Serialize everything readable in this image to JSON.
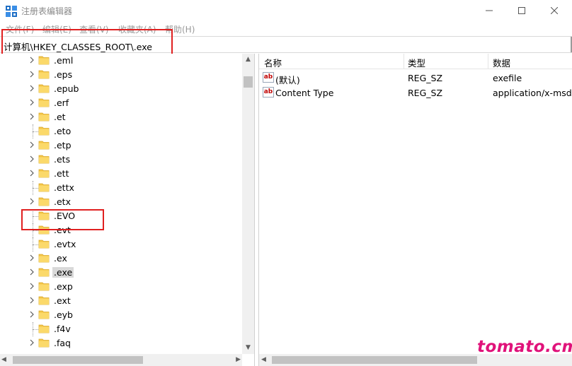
{
  "window": {
    "title": "注册表编辑器",
    "controls": {
      "minimize": "—",
      "maximize": "☐",
      "close": "✕"
    }
  },
  "menu": [
    {
      "label": "文件(F)"
    },
    {
      "label": "编辑(E)"
    },
    {
      "label": "查看(V)"
    },
    {
      "label": "收藏夹(A)"
    },
    {
      "label": "帮助(H)"
    }
  ],
  "address": {
    "path": "计算机\\HKEY_CLASSES_ROOT\\.exe"
  },
  "tree": {
    "items": [
      {
        "label": ".eml",
        "expandable": true,
        "selected": false
      },
      {
        "label": ".eps",
        "expandable": true,
        "selected": false
      },
      {
        "label": ".epub",
        "expandable": true,
        "selected": false
      },
      {
        "label": ".erf",
        "expandable": true,
        "selected": false
      },
      {
        "label": ".et",
        "expandable": true,
        "selected": false
      },
      {
        "label": ".eto",
        "expandable": false,
        "selected": false
      },
      {
        "label": ".etp",
        "expandable": true,
        "selected": false
      },
      {
        "label": ".ets",
        "expandable": true,
        "selected": false
      },
      {
        "label": ".ett",
        "expandable": true,
        "selected": false
      },
      {
        "label": ".ettx",
        "expandable": false,
        "selected": false
      },
      {
        "label": ".etx",
        "expandable": true,
        "selected": false
      },
      {
        "label": ".EVO",
        "expandable": false,
        "selected": false
      },
      {
        "label": ".evt",
        "expandable": false,
        "selected": false
      },
      {
        "label": ".evtx",
        "expandable": false,
        "selected": false
      },
      {
        "label": ".ex",
        "expandable": true,
        "selected": false
      },
      {
        "label": ".exe",
        "expandable": true,
        "selected": true
      },
      {
        "label": ".exp",
        "expandable": true,
        "selected": false
      },
      {
        "label": ".ext",
        "expandable": true,
        "selected": false
      },
      {
        "label": ".eyb",
        "expandable": true,
        "selected": false
      },
      {
        "label": ".f4v",
        "expandable": false,
        "selected": false
      },
      {
        "label": ".faq",
        "expandable": true,
        "selected": false
      }
    ]
  },
  "list": {
    "columns": [
      {
        "label": "名称"
      },
      {
        "label": "类型"
      },
      {
        "label": "数据"
      }
    ],
    "rows": [
      {
        "name": "(默认)",
        "type": "REG_SZ",
        "data": "exefile",
        "icon": "string-value-icon"
      },
      {
        "name": "Content Type",
        "type": "REG_SZ",
        "data": "application/x-msdos",
        "icon": "string-value-icon"
      }
    ],
    "icon_text": "ab"
  },
  "watermark": {
    "text": "tomato.cm"
  },
  "colors": {
    "highlight_border": "#e02020",
    "selected_bg": "#d9d9d9",
    "folder": "#f5c648",
    "watermark": "#e0127a"
  }
}
